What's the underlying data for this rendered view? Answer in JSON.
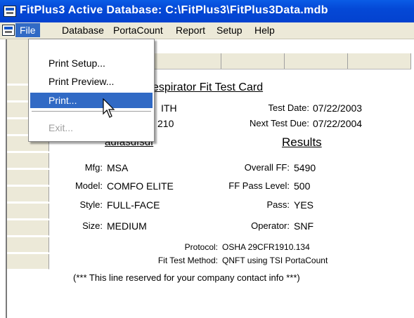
{
  "window": {
    "title": "FitPlus3    Active Database: C:\\FitPlus3\\FitPlus3Data.mdb"
  },
  "menubar": {
    "items": [
      "File",
      "Database",
      "PortaCount",
      "Report",
      "Setup",
      "Help"
    ]
  },
  "file_menu": {
    "items": [
      "Print Setup...",
      "Print Preview...",
      "Print...",
      "Exit..."
    ]
  },
  "card": {
    "title": "Respirator Fit Test Card",
    "title_visible": "espirator Fit Test Card",
    "name_partial": "ITH",
    "id_partial": "210",
    "test_date_label": "Test Date:",
    "test_date": "07/22/2003",
    "next_due_label": "Next Test Due:",
    "next_due": "07/22/2004",
    "respirator_header_partial": "adfasdfsdf",
    "results_header": "Results",
    "mfg_label": "Mfg:",
    "mfg": "MSA",
    "model_label": "Model:",
    "model": "COMFO ELITE",
    "style_label": "Style:",
    "style": "FULL-FACE",
    "size_label": "Size:",
    "size": "MEDIUM",
    "overall_ff_label": "Overall FF:",
    "overall_ff": "5490",
    "ff_pass_label": "FF Pass Level:",
    "ff_pass": "500",
    "pass_label": "Pass:",
    "pass": "YES",
    "operator_label": "Operator:",
    "operator": "SNF",
    "protocol_label": "Protocol:",
    "protocol": "OSHA 29CFR1910.134",
    "method_label": "Fit Test Method:",
    "method": "QNFT using TSI PortaCount",
    "contact_line": "(*** This line reserved for your company contact info ***)"
  },
  "colors": {
    "titlebar": "#0448d6",
    "menu_highlight": "#316ac5",
    "menubar_bg": "#ece9d8"
  }
}
